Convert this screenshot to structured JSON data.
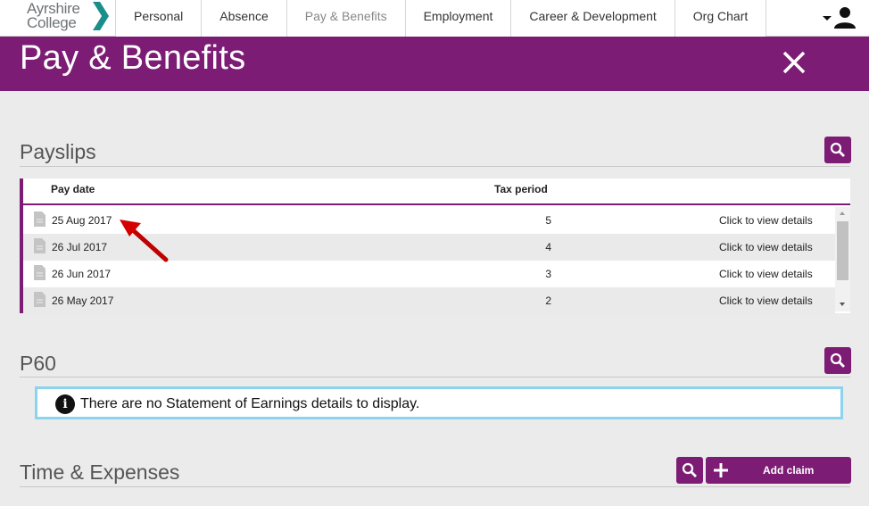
{
  "brand": {
    "logo_line1": "Ayrshire",
    "logo_line2": "College",
    "accent": "#7d1c74",
    "logo_mark_color": "#1a8f8a"
  },
  "nav": {
    "tabs": [
      {
        "label": "Personal",
        "active": false
      },
      {
        "label": "Absence",
        "active": false
      },
      {
        "label": "Pay & Benefits",
        "active": true
      },
      {
        "label": "Employment",
        "active": false
      },
      {
        "label": "Career & Development",
        "active": false
      },
      {
        "label": "Org Chart",
        "active": false
      }
    ],
    "user_icon": "user-icon"
  },
  "header": {
    "title": "Pay & Benefits",
    "close_icon": "close-icon"
  },
  "payslips": {
    "title": "Payslips",
    "columns": {
      "pay_date": "Pay date",
      "tax_period": "Tax period"
    },
    "rows": [
      {
        "date": "25 Aug 2017",
        "tax_period": "5",
        "link": "Click to view details"
      },
      {
        "date": "26 Jul 2017",
        "tax_period": "4",
        "link": "Click to view details"
      },
      {
        "date": "26 Jun 2017",
        "tax_period": "3",
        "link": "Click to view details"
      },
      {
        "date": "26 May 2017",
        "tax_period": "2",
        "link": "Click to view details"
      }
    ]
  },
  "p60": {
    "title": "P60",
    "notice": "There are no Statement of Earnings details to display.",
    "notice_border_color": "#8cd3ee"
  },
  "expenses": {
    "title": "Time & Expenses",
    "add_claim_label": "Add claim"
  }
}
